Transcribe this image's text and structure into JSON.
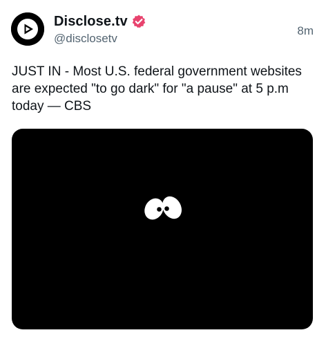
{
  "post": {
    "author": {
      "display_name": "Disclose.tv",
      "handle": "@disclosetv",
      "avatar_icon": "play-logo-icon",
      "verified_icon": "verified-badge-icon",
      "verified_color": "#e8436e"
    },
    "timestamp": "8m",
    "text": "JUST IN - Most U.S. federal government websites are expected \"to go dark\" for \"a pause\" at 5 p.m today — CBS",
    "media": {
      "background_color": "#000000",
      "icon": "peeking-eyes-icon"
    }
  }
}
